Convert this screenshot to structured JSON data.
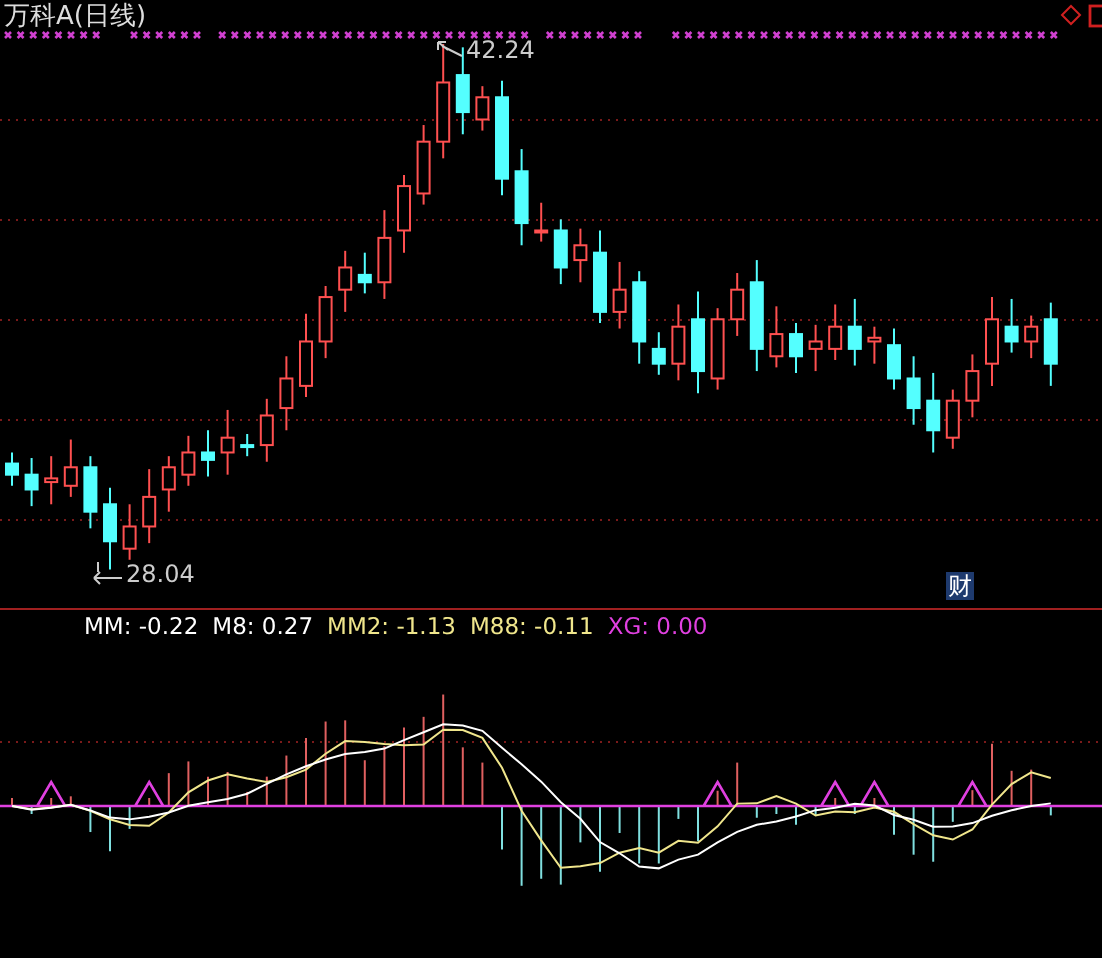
{
  "chart": {
    "title": "万科A(日线)",
    "high_label": "42.24",
    "low_label": "28.04",
    "badge": "财"
  },
  "indicator": {
    "legend": [
      {
        "name": "MM:",
        "value": "-0.22",
        "color": "#ffffff"
      },
      {
        "name": "M8:",
        "value": "0.27",
        "color": "#ffffff"
      },
      {
        "name": "MM2:",
        "value": "-1.13",
        "color": "#f0e68c"
      },
      {
        "name": "M88:",
        "value": "-0.11",
        "color": "#f0e68c"
      },
      {
        "name": "XG:",
        "value": "0.00",
        "color": "#e040e0"
      }
    ]
  }
}
